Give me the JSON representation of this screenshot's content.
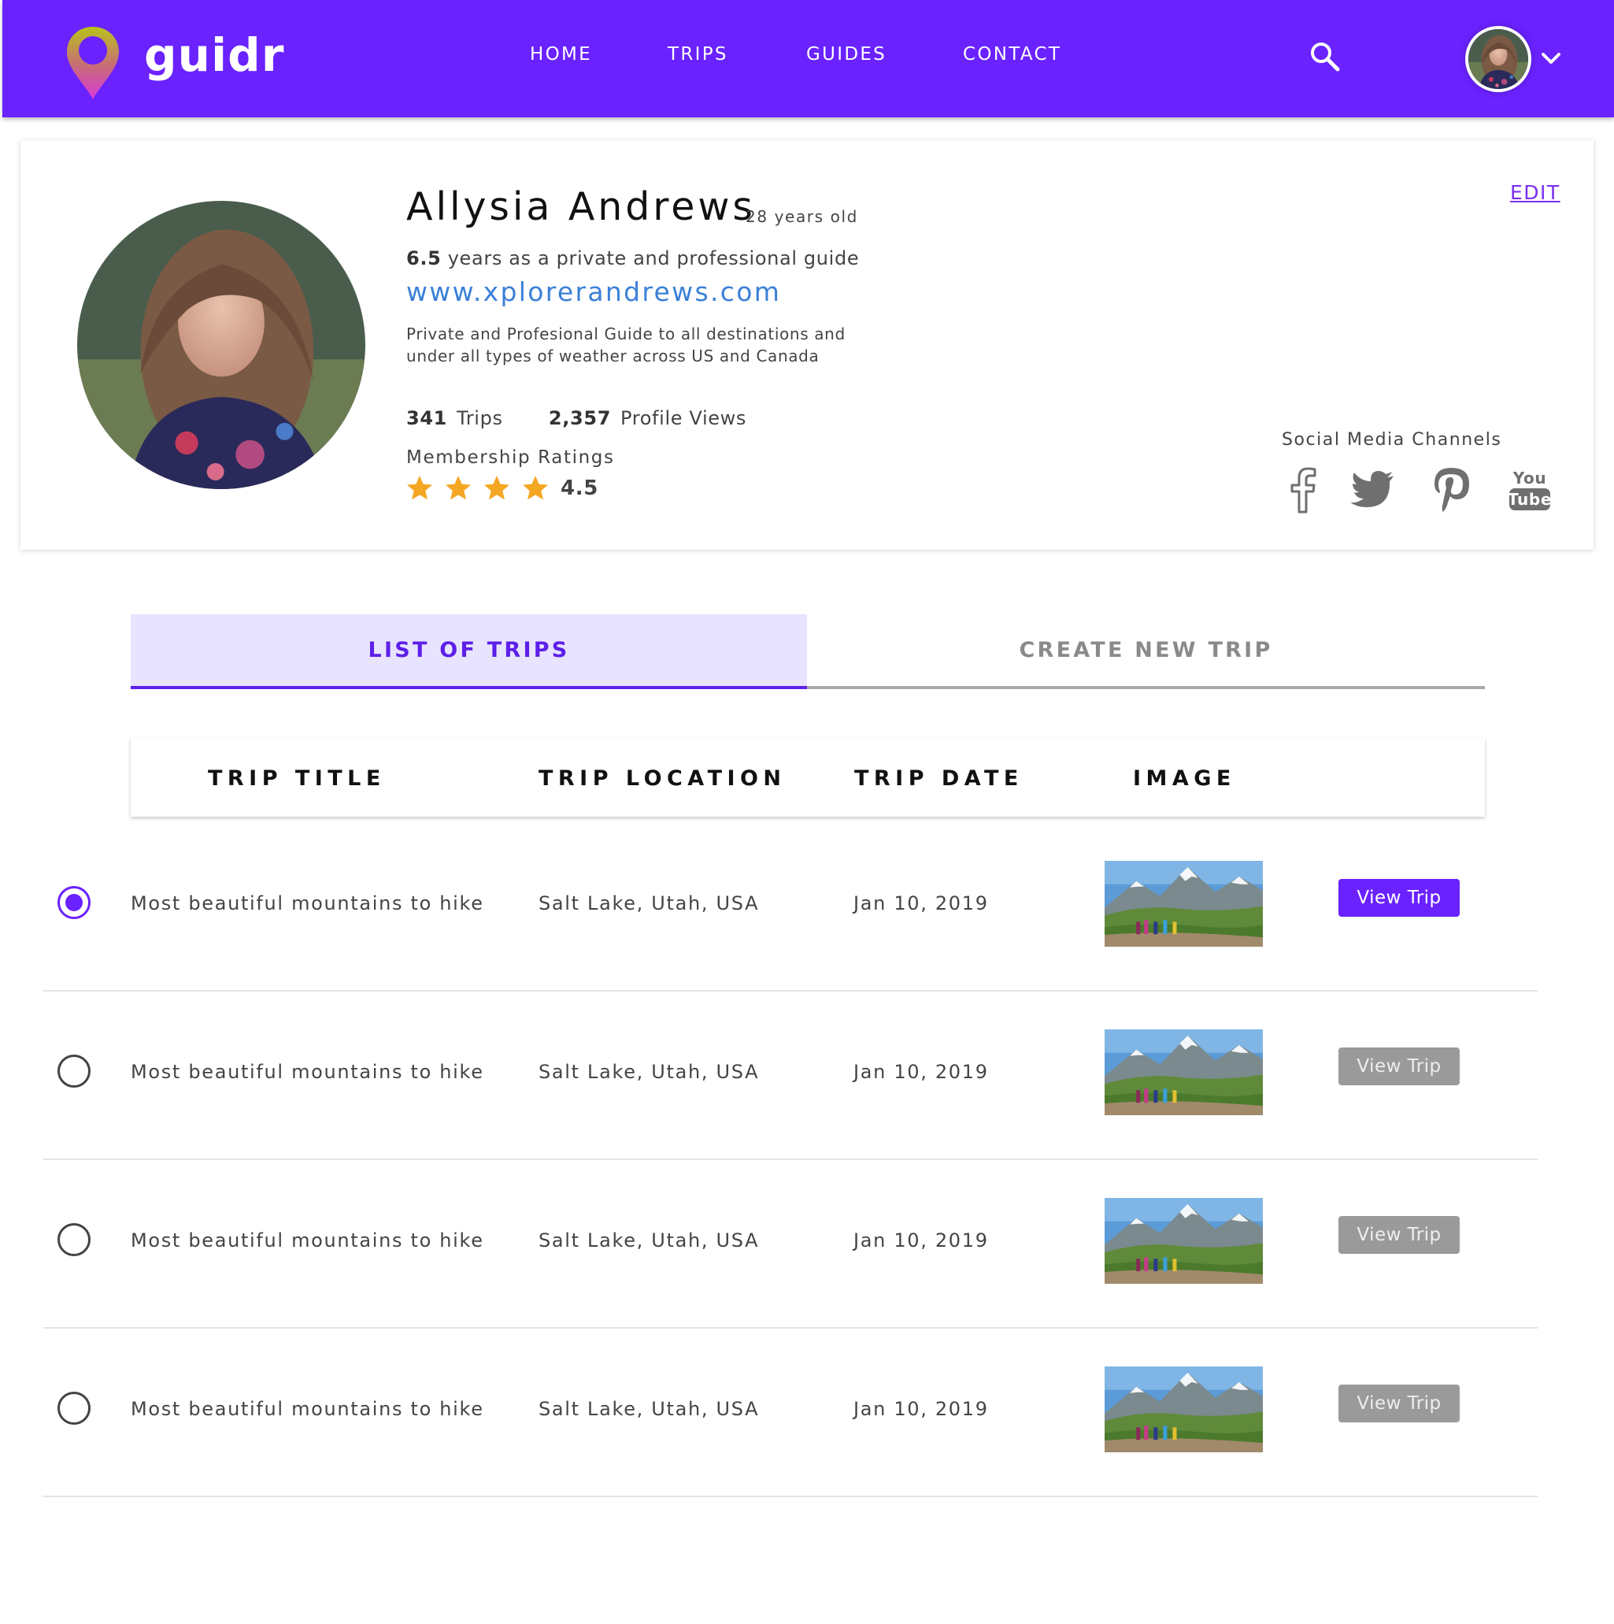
{
  "brand": {
    "name": "guidr"
  },
  "nav": {
    "links": [
      "HOME",
      "TRIPS",
      "GUIDES",
      "CONTACT"
    ]
  },
  "colors": {
    "primary": "#6a22ff",
    "tab_active_bg": "#e8e3ff",
    "link": "#3b80d8",
    "star": "#f5a623",
    "button_disabled": "#9a9a9a"
  },
  "profile": {
    "name": "Allysia Andrews",
    "age": "28 years old",
    "experience_years": "6.5",
    "experience_text": "years as a private and professional guide",
    "website": "www.xplorerandrews.com",
    "bio": "Private and Profesional Guide to all destinations and under all types of weather across US and Canada",
    "trips_count": "341",
    "trips_label": "Trips",
    "views_count": "2,357",
    "views_label": "Profile Views",
    "ratings_label": "Membership Ratings",
    "rating_value": "4.5",
    "stars_shown": 4,
    "edit_label": "EDIT",
    "social_label": "Social Media Channels",
    "social_icons": [
      "facebook-icon",
      "twitter-icon",
      "pinterest-icon",
      "youtube-icon"
    ]
  },
  "tabs": {
    "list": "LIST OF TRIPS",
    "create": "CREATE NEW TRIP",
    "active": "list"
  },
  "table": {
    "headers": [
      "TRIP TITLE",
      "TRIP LOCATION",
      "TRIP DATE",
      "IMAGE"
    ],
    "rows": [
      {
        "title": "Most beautiful mountains to hike",
        "location": "Salt Lake, Utah, USA",
        "date": "Jan 10, 2019",
        "button": "View Trip",
        "selected": true
      },
      {
        "title": "Most beautiful mountains to hike",
        "location": "Salt Lake, Utah, USA",
        "date": "Jan 10, 2019",
        "button": "View Trip",
        "selected": false
      },
      {
        "title": "Most beautiful mountains to hike",
        "location": "Salt Lake, Utah, USA",
        "date": "Jan 10, 2019",
        "button": "View Trip",
        "selected": false
      },
      {
        "title": "Most beautiful mountains to hike",
        "location": "Salt Lake, Utah, USA",
        "date": "Jan 10, 2019",
        "button": "View Trip",
        "selected": false
      }
    ]
  }
}
